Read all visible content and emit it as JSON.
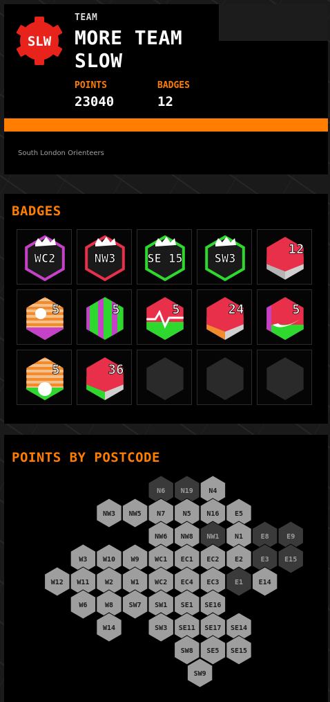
{
  "header": {
    "logo_text": "SLW",
    "team_label": "TEAM",
    "team_name_line1": "MORE TEAM",
    "team_name_line2": "SLOW",
    "points_label": "POINTS",
    "points_value": "23040",
    "badges_label": "BADGES",
    "badges_value": "12",
    "club_name": "South London Orienteers"
  },
  "badges": {
    "title": "BADGES",
    "items": [
      {
        "text": "WC2",
        "kind": "crown",
        "fill": "#1a1a1a",
        "stroke": "#c542c8",
        "accent": "#c542c8"
      },
      {
        "text": "NW3",
        "kind": "crown",
        "fill": "#1a1a1a",
        "stroke": "#e8304a",
        "accent": "#e8304a"
      },
      {
        "text": "SE 15",
        "kind": "crown",
        "fill": "#1a1a1a",
        "stroke": "#2ed82e",
        "accent": "#2ed82e"
      },
      {
        "text": "SW3",
        "kind": "crown",
        "fill": "#1a1a1a",
        "stroke": "#2ed82e",
        "accent": "#2ed82e"
      },
      {
        "text": "12",
        "kind": "cube",
        "fill": "#e8304a",
        "stroke": "#e8304a",
        "accent": "#b5b5b5"
      },
      {
        "text": "5",
        "kind": "moon",
        "fill": "#f28a2e",
        "stroke": "#f28a2e",
        "accent": "#c542c8"
      },
      {
        "text": "5",
        "kind": "stripes",
        "fill": "#2ed82e",
        "stroke": "#2ed82e",
        "accent": "#c542c8"
      },
      {
        "text": "5",
        "kind": "pulse",
        "fill": "#e8304a",
        "stroke": "#e8304a",
        "accent": "#2ed82e"
      },
      {
        "text": "24",
        "kind": "cube",
        "fill": "#e8304a",
        "stroke": "#e8304a",
        "accent": "#f28a2e"
      },
      {
        "text": "5",
        "kind": "swoosh",
        "fill": "#e8304a",
        "stroke": "#e8304a",
        "accent": "#2ed82e"
      },
      {
        "text": "5",
        "kind": "sunrise",
        "fill": "#f28a2e",
        "stroke": "#f28a2e",
        "accent": "#2ed82e"
      },
      {
        "text": "36",
        "kind": "cube",
        "fill": "#e8304a",
        "stroke": "#e8304a",
        "accent": "#2ed82e"
      },
      {
        "text": "",
        "kind": "empty",
        "fill": "#2a2a2a",
        "stroke": "#2a2a2a",
        "accent": "#2a2a2a"
      },
      {
        "text": "",
        "kind": "empty",
        "fill": "#2a2a2a",
        "stroke": "#2a2a2a",
        "accent": "#2a2a2a"
      },
      {
        "text": "",
        "kind": "empty",
        "fill": "#2a2a2a",
        "stroke": "#2a2a2a",
        "accent": "#2a2a2a"
      }
    ]
  },
  "postcodes": {
    "title": "POINTS BY POSTCODE",
    "colors": {
      "light": "#9e9e9e",
      "dark": "#3a3a3a",
      "text": "#1a1a1a",
      "dark_text": "#9e9e9e"
    },
    "rows": [
      {
        "offset": 4.5,
        "cells": [
          {
            "code": "N6",
            "dark": true
          },
          {
            "code": "N19",
            "dark": true
          },
          {
            "code": "N4",
            "dark": false
          }
        ]
      },
      {
        "offset": 2.5,
        "cells": [
          {
            "code": "NW3",
            "dark": false
          },
          {
            "code": "NW5",
            "dark": false
          },
          {
            "code": "N7",
            "dark": false
          },
          {
            "code": "N5",
            "dark": false
          },
          {
            "code": "N16",
            "dark": false
          },
          {
            "code": "E5",
            "dark": false
          }
        ]
      },
      {
        "offset": 4.5,
        "cells": [
          {
            "code": "NW6",
            "dark": false
          },
          {
            "code": "NW8",
            "dark": false
          },
          {
            "code": "NW1",
            "dark": true
          },
          {
            "code": "N1",
            "dark": false
          },
          {
            "code": "E8",
            "dark": true
          },
          {
            "code": "E9",
            "dark": true
          }
        ]
      },
      {
        "offset": 1.5,
        "cells": [
          {
            "code": "W3",
            "dark": false
          },
          {
            "code": "W10",
            "dark": false
          },
          {
            "code": "W9",
            "dark": false
          },
          {
            "code": "WC1",
            "dark": false
          },
          {
            "code": "EC1",
            "dark": false
          },
          {
            "code": "EC2",
            "dark": false
          },
          {
            "code": "E2",
            "dark": false
          },
          {
            "code": "E3",
            "dark": true
          },
          {
            "code": "E15",
            "dark": true
          }
        ]
      },
      {
        "offset": 0.5,
        "cells": [
          {
            "code": "W12",
            "dark": false
          },
          {
            "code": "W11",
            "dark": false
          },
          {
            "code": "W2",
            "dark": false
          },
          {
            "code": "W1",
            "dark": false
          },
          {
            "code": "WC2",
            "dark": false
          },
          {
            "code": "EC4",
            "dark": false
          },
          {
            "code": "EC3",
            "dark": false
          },
          {
            "code": "E1",
            "dark": true
          },
          {
            "code": "E14",
            "dark": false
          }
        ]
      },
      {
        "offset": 1.5,
        "cells": [
          {
            "code": "W6",
            "dark": false
          },
          {
            "code": "W8",
            "dark": false
          },
          {
            "code": "SW7",
            "dark": false
          },
          {
            "code": "SW1",
            "dark": false
          },
          {
            "code": "SE1",
            "dark": false
          },
          {
            "code": "SE16",
            "dark": false
          }
        ]
      },
      {
        "offset": 2.5,
        "cells": [
          {
            "code": "W14",
            "dark": false
          },
          {
            "code": "",
            "gap": true
          },
          {
            "code": "SW3",
            "dark": false
          },
          {
            "code": "SE11",
            "dark": false
          },
          {
            "code": "SE17",
            "dark": false
          },
          {
            "code": "SE14",
            "dark": false
          }
        ]
      },
      {
        "offset": 5.5,
        "cells": [
          {
            "code": "SW8",
            "dark": false
          },
          {
            "code": "SE5",
            "dark": false
          },
          {
            "code": "SE15",
            "dark": false
          }
        ]
      },
      {
        "offset": 6.0,
        "cells": [
          {
            "code": "SW9",
            "dark": false
          }
        ]
      }
    ]
  }
}
